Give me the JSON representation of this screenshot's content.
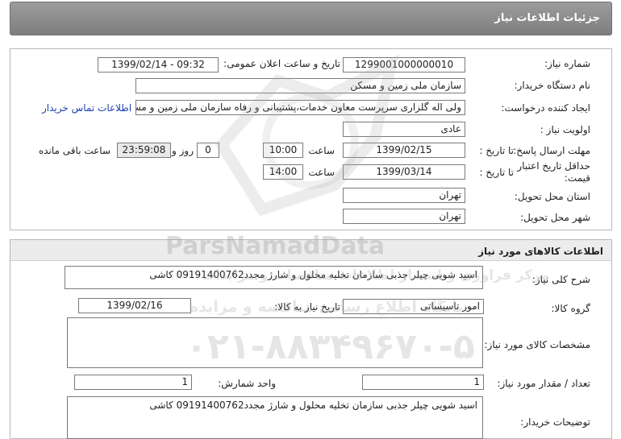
{
  "header": {
    "title": "جزئیات اطلاعات نیاز"
  },
  "need_info": {
    "need_number_label": "شماره نیاز:",
    "need_number": "1299001000000010",
    "announce_label": "تاریخ و ساعت اعلان عمومی:",
    "announce_value": "1399/02/14 - 09:32",
    "buyer_org_label": "نام دستگاه خریدار:",
    "buyer_org": "سازمان ملی زمین و مسکن",
    "creator_label": "ایجاد کننده درخواست:",
    "creator": "ولی اله گلزاری سرپرست معاون خدمات،پشتیبانی و رفاه سازمان ملی زمین و مس",
    "contact_link": "اطلاعات تماس خریدار",
    "priority_label": "اولویت نیاز :",
    "priority": "عادی",
    "deadline_label": "مهلت ارسال پاسخ:",
    "to_date_label": "تا تاریخ :",
    "deadline_date": "1399/02/15",
    "time_label": "ساعت",
    "deadline_time": "10:00",
    "days_value": "0",
    "days_label": "روز و",
    "remaining_time": "23:59:08",
    "remaining_label": "ساعت باقی مانده",
    "validity_label": "حداقل تاریخ اعتبار قیمت:",
    "validity_to_label": "تا تاریخ :",
    "validity_date": "1399/03/14",
    "validity_time_label": "ساعت",
    "validity_time": "14:00",
    "province_label": "استان محل تحویل:",
    "province": "تهران",
    "city_label": "شهر محل تحویل:",
    "city": "تهران"
  },
  "goods": {
    "section_title": "اطلاعات کالاهای مورد نیاز",
    "general_desc_label": "شرح کلی نیاز:",
    "general_desc": "اسید شویی چیلر جذبی سازمان تخلیه محلول و شارژ مجدد09191400762 کاشی",
    "group_label": "گروه کالا:",
    "group": "امور تاسیساتی",
    "need_date_label": "تاریخ نیاز به کالا:",
    "need_date": "1399/02/16",
    "specs_label": "مشخصات کالای مورد نیاز:",
    "specs": "",
    "count_label": "تعداد / مقدار مورد نیاز:",
    "count": "1",
    "unit_label": "واحد شمارش:",
    "unit": "1",
    "buyer_notes_label": "توضیحات خریدار:",
    "buyer_notes": "اسید شویی چیلر جذبی سازمان تخلیه محلول و شارژ مجدد09191400762 کاشی"
  },
  "watermark": {
    "brand": "ParsNamadData",
    "tagline": "مرکز فراوری و انتشار اطلاعات مناقصات و مزایدات",
    "sub": "پایگاه اطلاع رسانی مناقصه و مزایده",
    "phone": "۰۲۱-۸۸۳۴۹۶۷۰-۵"
  }
}
